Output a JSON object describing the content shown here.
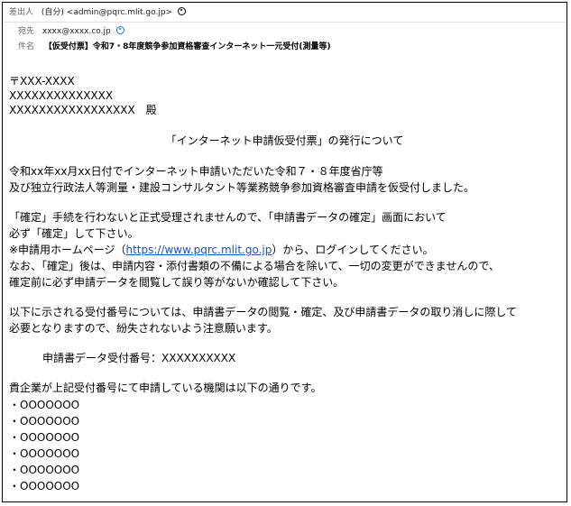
{
  "header": {
    "from_label": "差出人",
    "from_value": "(自分) <admin@pqrc.mlit.go.jp>",
    "to_label": "宛先",
    "to_value": "xxxx@xxxx.co.jp",
    "subject_label": "件名",
    "subject_value": "【仮受付票】令和7・8年度競争参加資格審査インターネット一元受付(測量等)"
  },
  "body": {
    "postal": "〒XXX-XXXX",
    "address": "XXXXXXXXXXXXXX",
    "recipient": "XXXXXXXXXXXXXXXXX　殿",
    "title": "「インターネット申請仮受付票」の発行について",
    "p1_l1": "令和xx年xx月xx日付でインターネット申請いただいた令和７・８年度省庁等",
    "p1_l2": "及び独立行政法人等測量・建設コンサルタント等業務競争参加資格審査申請を仮受付しました。",
    "p2_l1": "「確定」手続を行わないと正式受理されませんので、「申請書データの確定」画面において",
    "p2_l2": "必ず「確定」して下さい。",
    "p2_l3_pre": "※申請用ホームページ（",
    "p2_l3_link": "https://www.pqrc.mlit.go.jp",
    "p2_l3_post": "）から、ログインしてください。",
    "p2_l4": "なお、「確定」後は、申請内容・添付書類の不備による場合を除いて、一切の変更ができませんので、",
    "p2_l5": "確定前に必ず申請データを閲覧して誤り等がないか確認して下さい。",
    "p3_l1": "以下に示される受付番号については、申請書データの閲覧・確定、及び申請書データの取り消しに際して",
    "p3_l2": "必要となりますので、紛失されないよう注意願います。",
    "receipt_number": "申請書データ受付番号：XXXXXXXXXX",
    "p4": "貴企業が上記受付番号にて申請している機関は以下の通りです。",
    "agencies": [
      "・OOOOOOO",
      "・OOOOOOO",
      "・OOOOOOO",
      "・OOOOOOO",
      "・OOOOOOO",
      "・OOOOOOO"
    ]
  },
  "colors": {
    "link": "#1f4fbf",
    "contact_icon": "#1a73e8"
  }
}
